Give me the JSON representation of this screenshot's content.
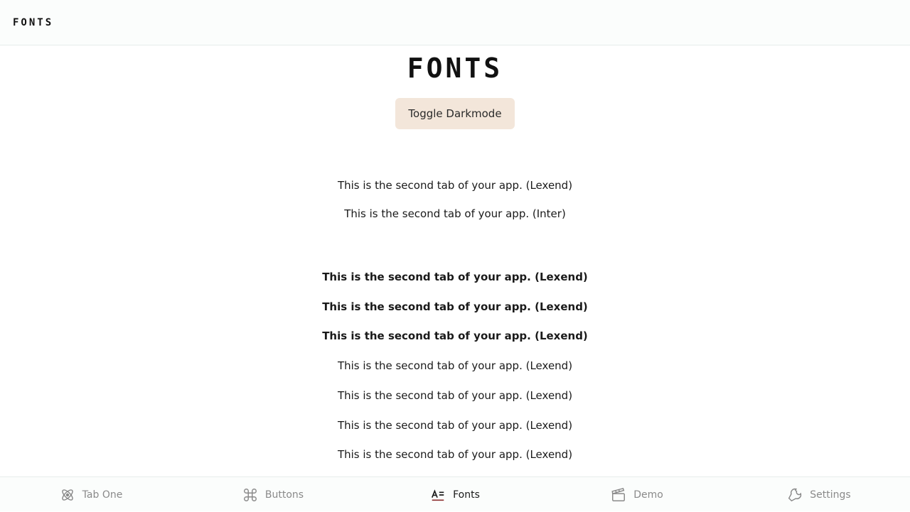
{
  "topbar": {
    "title": "FONTS"
  },
  "main": {
    "title": "FONTS",
    "toggle_label": "Toggle Darkmode",
    "lines": [
      "This is the second tab of your app. (Lexend)",
      "This is the second tab of your app. (Inter)",
      "This is the second tab of your app. (Lexend)",
      "This is the second tab of your app. (Lexend)",
      "This is the second tab of your app. (Lexend)",
      "This is the second tab of your app. (Lexend)",
      "This is the second tab of your app. (Lexend)",
      "This is the second tab of your app. (Lexend)",
      "This is the second tab of your app. (Lexend)"
    ]
  },
  "tabs": [
    {
      "label": "Tab One",
      "icon": "atom-icon"
    },
    {
      "label": "Buttons",
      "icon": "command-icon"
    },
    {
      "label": "Fonts",
      "icon": "text-align-icon",
      "active": true
    },
    {
      "label": "Demo",
      "icon": "clapperboard-icon"
    },
    {
      "label": "Settings",
      "icon": "wrench-icon"
    }
  ],
  "colors": {
    "toggle_bg": "#f3e6da",
    "active_tab_icon": "#8b2d2d",
    "inactive_tab": "#8a8a8a"
  }
}
